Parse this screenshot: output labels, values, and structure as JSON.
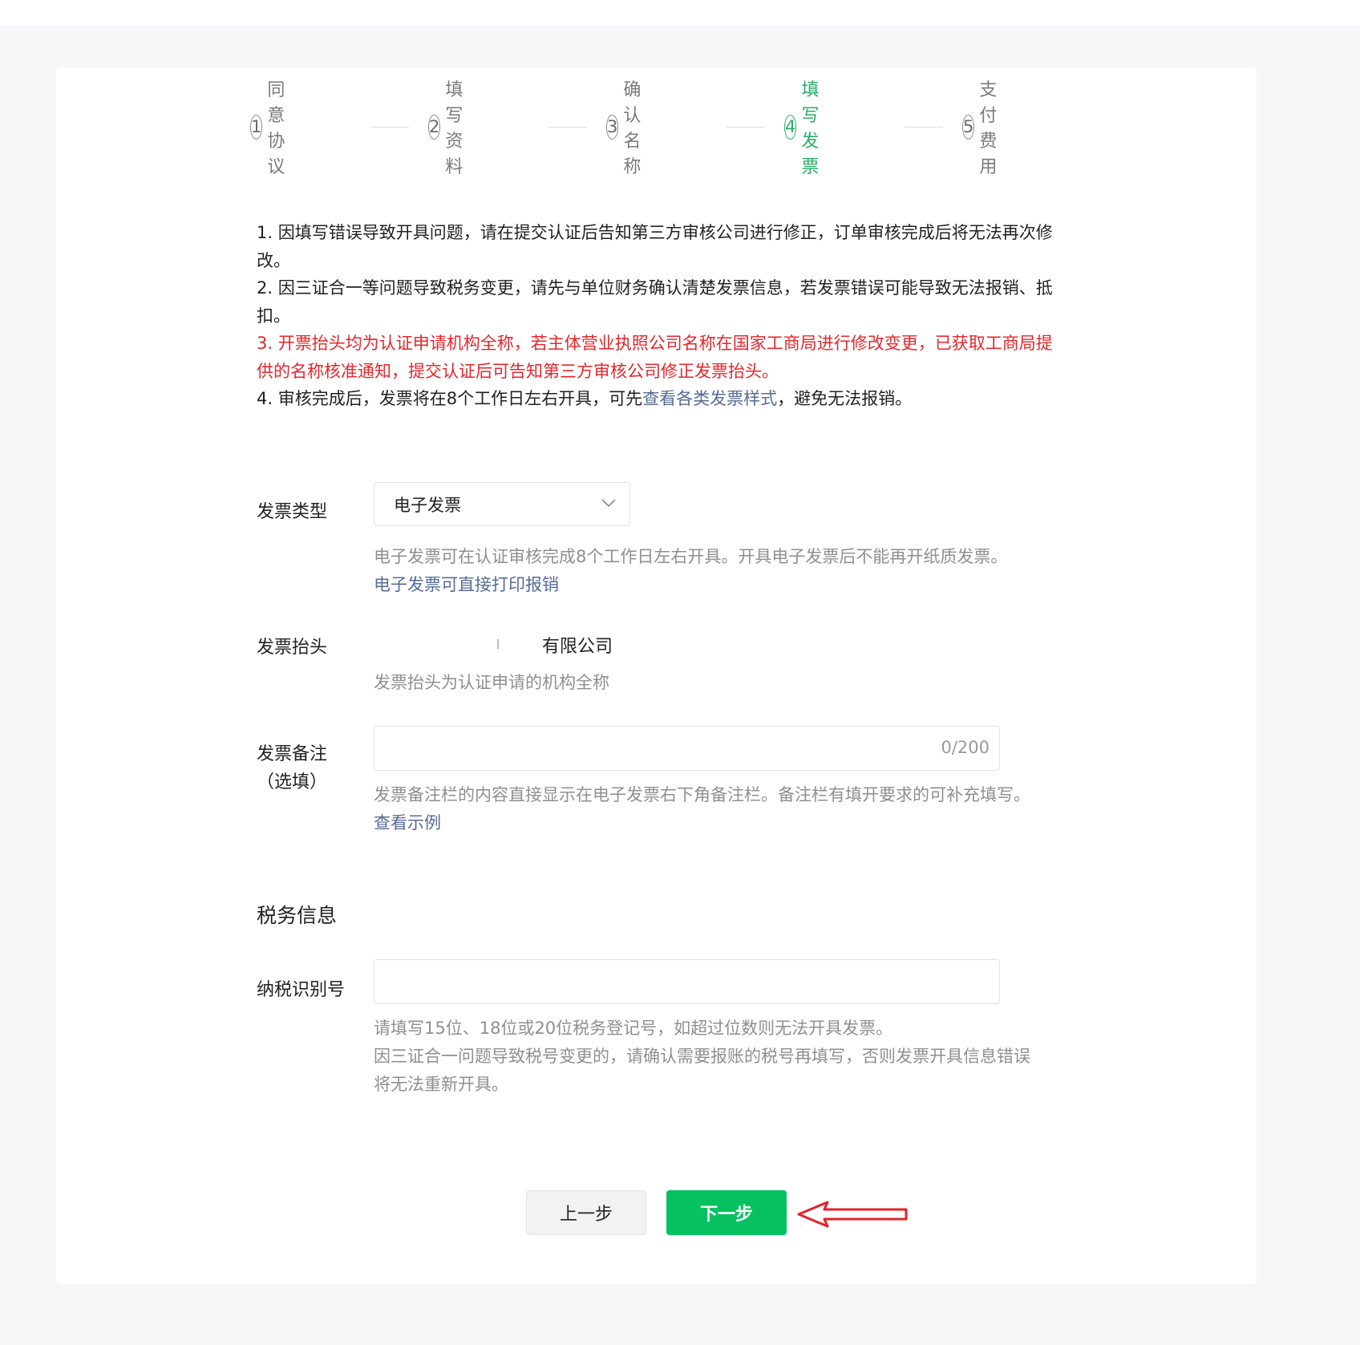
{
  "steps": [
    {
      "num": "1",
      "label": "同意协议"
    },
    {
      "num": "2",
      "label": "填写资料"
    },
    {
      "num": "3",
      "label": "确认名称"
    },
    {
      "num": "4",
      "label": "填写发票"
    },
    {
      "num": "5",
      "label": "支付费用"
    }
  ],
  "active_step": 4,
  "notice": {
    "line1": "1. 因填写错误导致开具问题，请在提交认证后告知第三方审核公司进行修正，订单审核完成后将无法再次修改。",
    "line2": "2. 因三证合一等问题导致税务变更，请先与单位财务确认清楚发票信息，若发票错误可能导致无法报销、抵扣。",
    "line3": "3. 开票抬头均为认证申请机构全称，若主体营业执照公司名称在国家工商局进行修改变更，已获取工商局提供的名称核准通知，提交认证后可告知第三方审核公司修正发票抬头。",
    "line4_prefix": "4. 审核完成后，发票将在8个工作日左右开具，可先",
    "line4_link": "查看各类发票样式",
    "line4_suffix": "，避免无法报销。"
  },
  "form": {
    "invoice_type_label": "发票类型",
    "invoice_type_value": "电子发票",
    "invoice_type_hint": "电子发票可在认证审核完成8个工作日左右开具。开具电子发票后不能再开纸质发票。",
    "invoice_type_hint_link": "电子发票可直接打印报销",
    "invoice_title_label": "发票抬头",
    "invoice_title_value": "有限公司",
    "invoice_title_hint": "发票抬头为认证申请的机构全称",
    "remark_label_line1": "发票备注",
    "remark_label_line2": "（选填）",
    "remark_value": "",
    "remark_counter": "0/200",
    "remark_hint": "发票备注栏的内容直接显示在电子发票右下角备注栏。备注栏有填开要求的可补充填写。",
    "remark_hint_link": "查看示例",
    "tax_section_title": "税务信息",
    "tax_id_label": "纳税识别号",
    "tax_id_value": "",
    "tax_id_hint_line1": "请填写15位、18位或20位税务登记号，如超过位数则无法开具发票。",
    "tax_id_hint_line2": "因三证合一问题导致税号变更的，请确认需要报账的税号再填写，否则发票开具信息错误",
    "tax_id_hint_line3": "将无法重新开具。"
  },
  "buttons": {
    "prev": "上一步",
    "next": "下一步"
  },
  "colors": {
    "accent_green": "#07c160",
    "step_active": "#2aae67",
    "warning_red": "#e5262c",
    "link_blue": "#576b95",
    "annotation_arrow": "#e0232b"
  },
  "icons": {
    "select_arrow": "chevron-down-icon",
    "annotation": "red-arrow-icon"
  }
}
